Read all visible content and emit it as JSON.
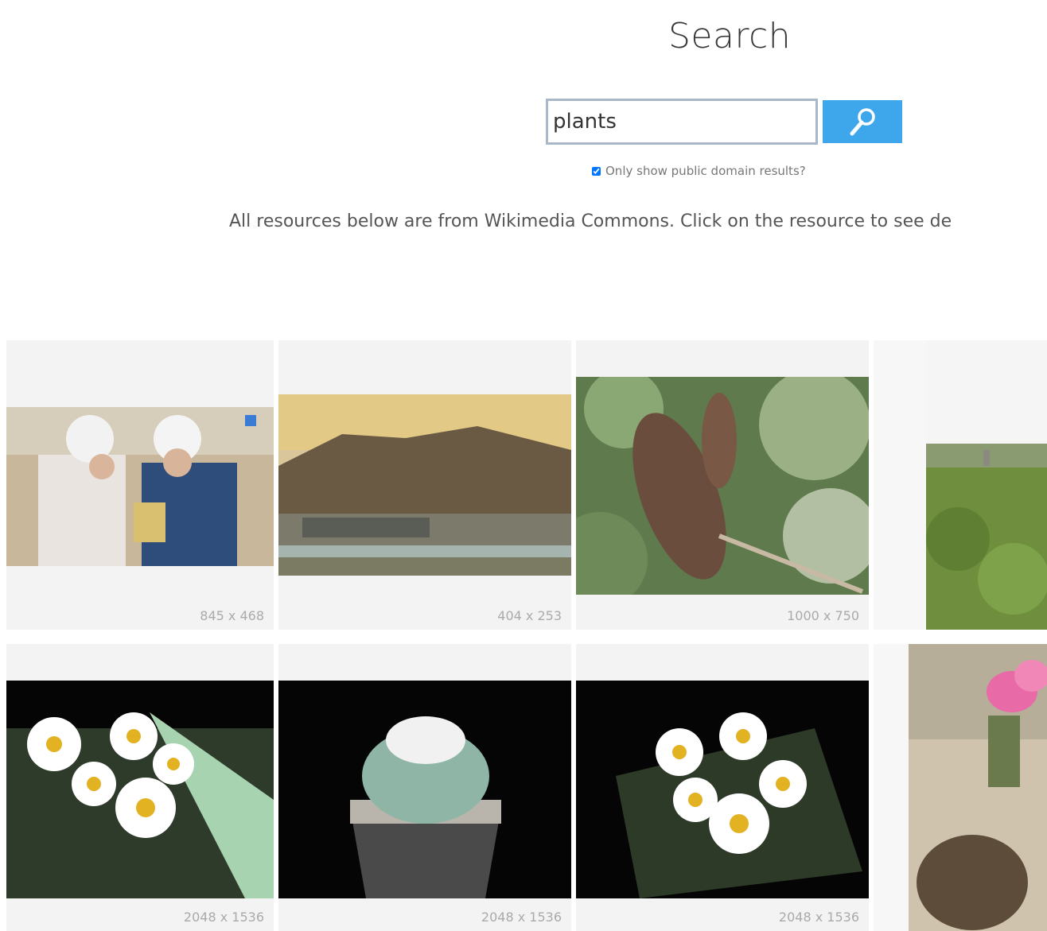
{
  "header": {
    "title": "Search"
  },
  "search": {
    "value": "plants",
    "button_icon": "search-icon"
  },
  "filters": {
    "public_domain_label": "Only show public domain results?",
    "public_domain_checked": true
  },
  "notice": "All resources below are from Wikimedia Commons. Click on the resource to see de",
  "results": [
    {
      "size": "845 x 468",
      "subject": "workers in hard hats"
    },
    {
      "size": "404 x 253",
      "subject": "vintage postcard landscape"
    },
    {
      "size": "1000 x 750",
      "subject": "banksia flower"
    },
    {
      "size": "",
      "subject": "green hillside"
    },
    {
      "size": "2048 x 1536",
      "subject": "cactus with daisy flowers"
    },
    {
      "size": "2048 x 1536",
      "subject": "white cactus in pot"
    },
    {
      "size": "2048 x 1536",
      "subject": "cactus with daisy flowers"
    },
    {
      "size": "",
      "subject": "pink cactus flower"
    }
  ],
  "colors": {
    "accent": "#3ea6ea",
    "card_bg": "#f3f3f3"
  }
}
